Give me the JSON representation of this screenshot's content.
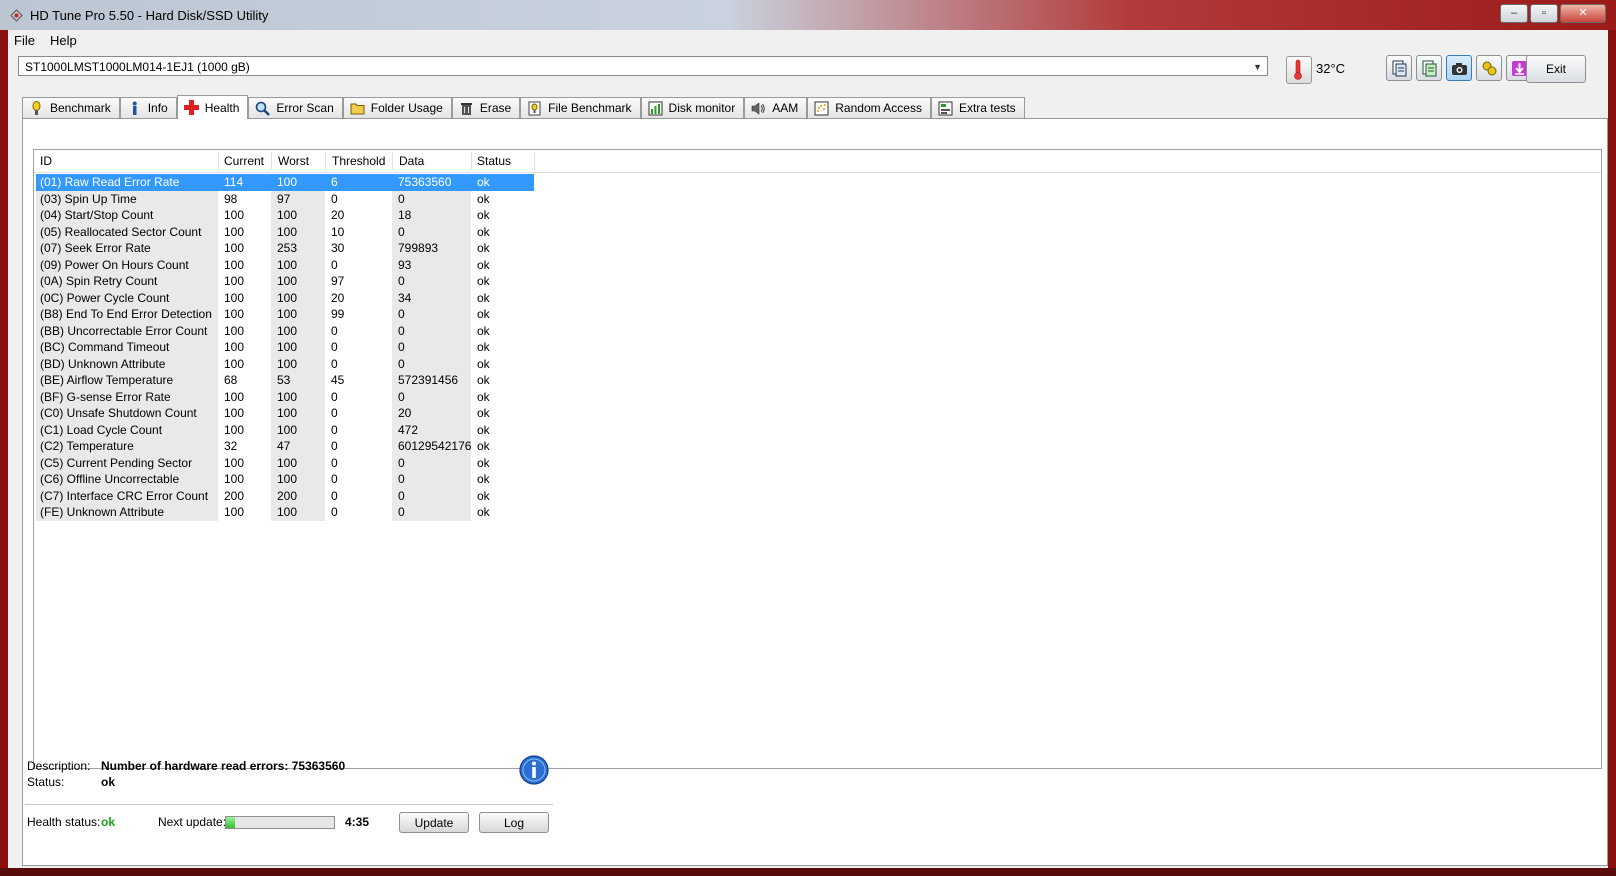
{
  "window": {
    "title": "HD Tune Pro 5.50 - Hard Disk/SSD Utility"
  },
  "menu": [
    "File",
    "Help"
  ],
  "toolbar": {
    "drive": "ST1000LMST1000LM014-1EJ1 (1000 gB)",
    "temperature": "32°C",
    "exit_label": "Exit"
  },
  "tabs": [
    {
      "label": "Benchmark",
      "icon": "benchmark-icon"
    },
    {
      "label": "Info",
      "icon": "info-icon"
    },
    {
      "label": "Health",
      "icon": "health-cross-icon",
      "active": true
    },
    {
      "label": "Error Scan",
      "icon": "magnifier-icon"
    },
    {
      "label": "Folder Usage",
      "icon": "folder-icon"
    },
    {
      "label": "Erase",
      "icon": "trash-icon"
    },
    {
      "label": "File Benchmark",
      "icon": "file-benchmark-icon"
    },
    {
      "label": "Disk monitor",
      "icon": "disk-monitor-icon"
    },
    {
      "label": "AAM",
      "icon": "speaker-icon"
    },
    {
      "label": "Random Access",
      "icon": "random-access-icon"
    },
    {
      "label": "Extra tests",
      "icon": "extra-tests-icon"
    }
  ],
  "table": {
    "headers": [
      "ID",
      "Current",
      "Worst",
      "Threshold",
      "Data",
      "Status"
    ],
    "rows": [
      [
        "(01) Raw Read Error Rate",
        "114",
        "100",
        "6",
        "75363560",
        "ok"
      ],
      [
        "(03) Spin Up Time",
        "98",
        "97",
        "0",
        "0",
        "ok"
      ],
      [
        "(04) Start/Stop Count",
        "100",
        "100",
        "20",
        "18",
        "ok"
      ],
      [
        "(05) Reallocated Sector Count",
        "100",
        "100",
        "10",
        "0",
        "ok"
      ],
      [
        "(07) Seek Error Rate",
        "100",
        "253",
        "30",
        "799893",
        "ok"
      ],
      [
        "(09) Power On Hours Count",
        "100",
        "100",
        "0",
        "93",
        "ok"
      ],
      [
        "(0A) Spin Retry Count",
        "100",
        "100",
        "97",
        "0",
        "ok"
      ],
      [
        "(0C) Power Cycle Count",
        "100",
        "100",
        "20",
        "34",
        "ok"
      ],
      [
        "(B8) End To End Error Detection",
        "100",
        "100",
        "99",
        "0",
        "ok"
      ],
      [
        "(BB) Uncorrectable Error Count",
        "100",
        "100",
        "0",
        "0",
        "ok"
      ],
      [
        "(BC) Command Timeout",
        "100",
        "100",
        "0",
        "0",
        "ok"
      ],
      [
        "(BD) Unknown Attribute",
        "100",
        "100",
        "0",
        "0",
        "ok"
      ],
      [
        "(BE) Airflow Temperature",
        "68",
        "53",
        "45",
        "572391456",
        "ok"
      ],
      [
        "(BF) G-sense Error Rate",
        "100",
        "100",
        "0",
        "0",
        "ok"
      ],
      [
        "(C0) Unsafe Shutdown Count",
        "100",
        "100",
        "0",
        "20",
        "ok"
      ],
      [
        "(C1) Load Cycle Count",
        "100",
        "100",
        "0",
        "472",
        "ok"
      ],
      [
        "(C2) Temperature",
        "32",
        "47",
        "0",
        "60129542176",
        "ok"
      ],
      [
        "(C5) Current Pending Sector",
        "100",
        "100",
        "0",
        "0",
        "ok"
      ],
      [
        "(C6) Offline Uncorrectable",
        "100",
        "100",
        "0",
        "0",
        "ok"
      ],
      [
        "(C7) Interface CRC Error Count",
        "200",
        "200",
        "0",
        "0",
        "ok"
      ],
      [
        "(FE) Unknown Attribute",
        "100",
        "100",
        "0",
        "0",
        "ok"
      ]
    ]
  },
  "details": {
    "description_label": "Description:",
    "description_value": "Number of hardware read errors: 75363560",
    "status_label": "Status:",
    "status_value": "ok"
  },
  "footer": {
    "health_label": "Health status:",
    "health_value": "ok",
    "next_update_label": "Next update:",
    "progress_fraction": 0.08,
    "countdown": "4:35",
    "update_label": "Update",
    "log_label": "Log"
  },
  "colors": {
    "selection": "#3399ff",
    "ok_green": "#1aa11a"
  }
}
